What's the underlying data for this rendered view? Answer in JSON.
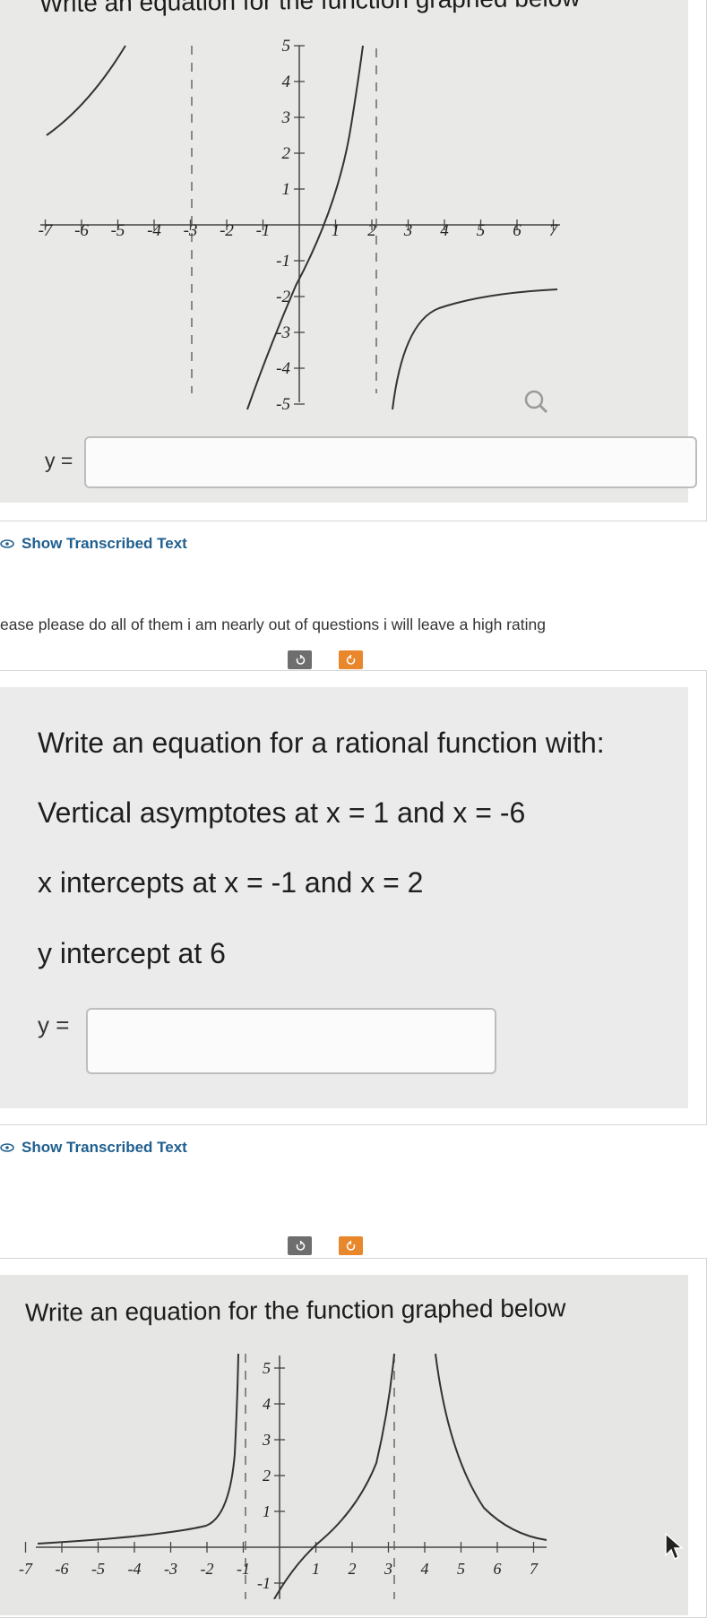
{
  "post1": {
    "title": "Write an equation for the function graphed below",
    "answer_label": "y =",
    "graph": {
      "x_ticks": [
        "-7",
        "-6",
        "-5",
        "-4",
        "-3",
        "-2",
        "-1",
        "1",
        "2",
        "3",
        "4",
        "5",
        "6",
        "7"
      ],
      "y_ticks_pos": [
        "5",
        "4",
        "3",
        "2",
        "1"
      ],
      "y_ticks_neg": [
        "-1",
        "-2",
        "-3",
        "-4",
        "-5"
      ]
    }
  },
  "show_transcribed_text": "Show Transcribed Text",
  "comment_text": "ease please do all of them i am nearly out of questions i will leave a high rating",
  "post2": {
    "lines": [
      "Write an equation for a rational function with:",
      "Vertical asymptotes at x = 1 and x = -6",
      "x intercepts at x = -1 and x = 2",
      "y intercept at 6"
    ],
    "answer_label": "y ="
  },
  "post3": {
    "title": "Write an equation for the function graphed below",
    "graph": {
      "x_ticks": [
        "-7",
        "-6",
        "-5",
        "-4",
        "-3",
        "-2",
        "-1",
        "1",
        "2",
        "3",
        "4",
        "5",
        "6",
        "7"
      ],
      "y_ticks_pos": [
        "5",
        "4",
        "3",
        "2",
        "1"
      ],
      "y_ticks_neg": [
        "-1"
      ]
    }
  },
  "icons": {
    "zoom": "magnifier-icon",
    "eye": "eye-icon",
    "rotate_left": "rotate-left-icon",
    "rotate_right": "rotate-right-icon",
    "cursor": "mouse-pointer-icon"
  },
  "colors": {
    "link": "#1f5f8f",
    "accent_orange": "#e8872b",
    "button_grey": "#6e6e6e"
  }
}
